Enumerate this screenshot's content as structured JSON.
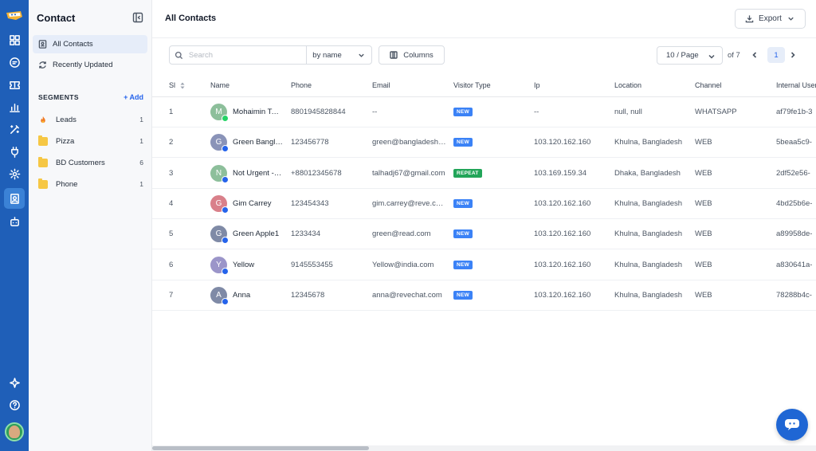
{
  "app": {
    "accent": "#1f5fb8",
    "active_bg": "#e6edf9"
  },
  "rail": {
    "icons": [
      "logo-icon",
      "dashboard-icon",
      "chat-icon",
      "ticket-icon",
      "report-icon",
      "magic-wand-icon",
      "plug-icon",
      "settings-icon",
      "contacts-icon",
      "bot-icon",
      "sparkle-icon",
      "help-icon"
    ]
  },
  "sidebar": {
    "title": "Contact",
    "nav": [
      {
        "label": "All Contacts",
        "active": true
      },
      {
        "label": "Recently Updated",
        "active": false
      }
    ],
    "segments_title": "SEGMENTS",
    "add_label": "+ Add",
    "segments": [
      {
        "label": "Leads",
        "count": "1",
        "icon": "fire-icon"
      },
      {
        "label": "Pizza",
        "count": "1",
        "icon": "folder-icon"
      },
      {
        "label": "BD Customers",
        "count": "6",
        "icon": "folder-icon"
      },
      {
        "label": "Phone",
        "count": "1",
        "icon": "folder-icon"
      }
    ]
  },
  "header": {
    "title": "All Contacts",
    "export_label": "Export"
  },
  "toolbar": {
    "search_placeholder": "Search",
    "search_by": "by name",
    "columns_label": "Columns"
  },
  "pagination": {
    "per_page": "10 / Page",
    "of_total": "of 7",
    "current_page": "1"
  },
  "table": {
    "columns": [
      "Sl",
      "Name",
      "Phone",
      "Email",
      "Visitor Type",
      "Ip",
      "Location",
      "Channel",
      "Internal User ID"
    ],
    "rows": [
      {
        "sl": "1",
        "initial": "M",
        "avatar_color": "#8dbf9b",
        "channel_icon": "whatsapp-icon",
        "name": "Mohaimin Tahmid",
        "phone": "8801945828844",
        "email": "--",
        "visitor_type": "NEW",
        "ip": "--",
        "location": "null, null",
        "channel": "WHATSAPP",
        "internal_id": "af79fe1b-3"
      },
      {
        "sl": "2",
        "initial": "G",
        "avatar_color": "#8a93b8",
        "channel_icon": "web-icon",
        "name": "Green Bangladesh",
        "phone": "123456778",
        "email": "green@bangladesh.com",
        "visitor_type": "NEW",
        "ip": "103.120.162.160",
        "location": "Khulna, Bangladesh",
        "channel": "WEB",
        "internal_id": "5beaa5c9-"
      },
      {
        "sl": "3",
        "initial": "N",
        "avatar_color": "#8dbf9b",
        "channel_icon": "web-icon",
        "name": "Not Urgent - Tal",
        "phone": "+88012345678",
        "email": "talhadj67@gmail.com",
        "visitor_type": "REPEAT",
        "ip": "103.169.159.34",
        "location": "Dhaka, Bangladesh",
        "channel": "WEB",
        "internal_id": "2df52e56-"
      },
      {
        "sl": "4",
        "initial": "G",
        "avatar_color": "#d9808a",
        "channel_icon": "web-icon",
        "name": "Gim Carrey",
        "phone": "123454343",
        "email": "gim.carrey@reve.com",
        "visitor_type": "NEW",
        "ip": "103.120.162.160",
        "location": "Khulna, Bangladesh",
        "channel": "WEB",
        "internal_id": "4bd25b6e-"
      },
      {
        "sl": "5",
        "initial": "G",
        "avatar_color": "#7f8aa6",
        "channel_icon": "web-icon",
        "name": "Green Apple1",
        "phone": "1233434",
        "email": "green@read.com",
        "visitor_type": "NEW",
        "ip": "103.120.162.160",
        "location": "Khulna, Bangladesh",
        "channel": "WEB",
        "internal_id": "a89958de-"
      },
      {
        "sl": "6",
        "initial": "Y",
        "avatar_color": "#9b95c9",
        "channel_icon": "web-icon",
        "name": "Yellow",
        "phone": "9145553455",
        "email": "Yellow@india.com",
        "visitor_type": "NEW",
        "ip": "103.120.162.160",
        "location": "Khulna, Bangladesh",
        "channel": "WEB",
        "internal_id": "a830641a-"
      },
      {
        "sl": "7",
        "initial": "A",
        "avatar_color": "#7f8aa6",
        "channel_icon": "web-icon",
        "name": "Anna",
        "phone": "12345678",
        "email": "anna@revechat.com",
        "visitor_type": "NEW",
        "ip": "103.120.162.160",
        "location": "Khulna, Bangladesh",
        "channel": "WEB",
        "internal_id": "78288b4c-"
      }
    ]
  },
  "colors": {
    "badge_new": "#3b82f6",
    "badge_repeat": "#22a559",
    "whatsapp": "#25d366",
    "web": "#2563eb"
  }
}
